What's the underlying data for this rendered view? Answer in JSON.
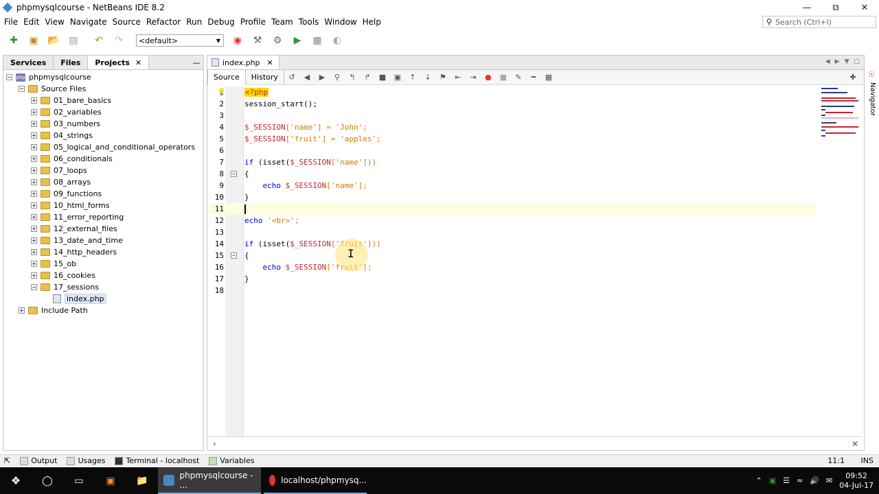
{
  "window": {
    "title": "phpmysqlcourse - NetBeans IDE 8.2"
  },
  "menu": [
    "File",
    "Edit",
    "View",
    "Navigate",
    "Source",
    "Refactor",
    "Run",
    "Debug",
    "Profile",
    "Team",
    "Tools",
    "Window",
    "Help"
  ],
  "search": {
    "placeholder": "Search (Ctrl+I)"
  },
  "toolbar": {
    "config_value": "<default>"
  },
  "left_panel": {
    "tabs": {
      "services": "Services",
      "files": "Files",
      "projects": "Projects"
    },
    "tree": {
      "project": "phpmysqlcourse",
      "source_files": "Source Files",
      "folders": [
        "01_bare_basics",
        "02_variables",
        "03_numbers",
        "04_strings",
        "05_logical_and_conditional_operators",
        "06_conditionals",
        "07_loops",
        "08_arrays",
        "09_functions",
        "10_html_forms",
        "11_error_reporting",
        "12_external_files",
        "13_date_and_time",
        "14_http_headers",
        "15_ob",
        "16_cookies",
        "17_sessions"
      ],
      "selected_file": "index.php",
      "include_path": "Include Path"
    }
  },
  "editor": {
    "tab_label": "index.php",
    "modes": {
      "source": "Source",
      "history": "History"
    },
    "line_numbers": [
      "1",
      "2",
      "3",
      "4",
      "5",
      "6",
      "7",
      "8",
      "9",
      "10",
      "11",
      "12",
      "13",
      "14",
      "15",
      "16",
      "17",
      "18"
    ],
    "code": {
      "l1": "<?php",
      "l2": "session_start();",
      "l4_var": "$_SESSION",
      "l4_rest": "['name'] = 'John';",
      "l5_var": "$_SESSION",
      "l5_rest": "['fruit'] = 'apples';",
      "l7_kw": "if",
      "l7_a": " (isset(",
      "l7_var": "$_SESSION",
      "l7_b": "['name']))",
      "l8": "{",
      "l9_kw": "echo",
      "l9_var": "$_SESSION",
      "l9_rest": "['name'];",
      "l10": "}",
      "l12_kw": "echo",
      "l12_rest": " '<br>';",
      "l14_kw": "if",
      "l14_a": " (isset(",
      "l14_var": "$_SESSION",
      "l14_b": "['fruit']))",
      "l15": "{",
      "l16_kw": "echo",
      "l16_var": "$_SESSION",
      "l16_rest": "['fruit'];",
      "l17": "}"
    }
  },
  "navigator": {
    "label": "Navigator"
  },
  "statusbar": {
    "output": "Output",
    "usages": "Usages",
    "terminal": "Terminal - localhost",
    "variables": "Variables",
    "position": "11:1",
    "mode": "INS"
  },
  "taskbar": {
    "app1": "phpmysqlcourse - ...",
    "app2": "localhost/phpmysq...",
    "time": "09:52",
    "date": "04-Jul-17"
  },
  "colors": {
    "keyword": "#0000e6",
    "variable": "#c1272d",
    "string": "#ce7b00",
    "php_tag_bg": "#ffd700"
  }
}
